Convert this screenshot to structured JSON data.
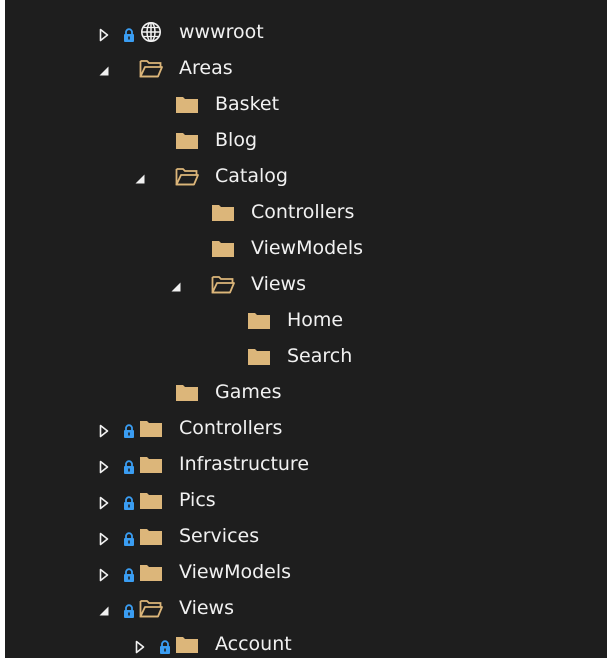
{
  "colors": {
    "panel_background": "#1e1e1e",
    "text": "#f1f1f1",
    "folder": "#dcb67a",
    "lock": "#3a9df2",
    "expander": "#f1f1f1"
  },
  "tree": {
    "items": [
      {
        "label": "wwwroot",
        "depth": 0,
        "expander": "collapsed",
        "icon": "globe-icon",
        "lock": true
      },
      {
        "label": "Areas",
        "depth": 0,
        "expander": "expanded",
        "icon": "folder-open-icon",
        "lock": false
      },
      {
        "label": "Basket",
        "depth": 1,
        "expander": "none",
        "icon": "folder-icon",
        "lock": false
      },
      {
        "label": "Blog",
        "depth": 1,
        "expander": "none",
        "icon": "folder-icon",
        "lock": false
      },
      {
        "label": "Catalog",
        "depth": 1,
        "expander": "expanded",
        "icon": "folder-open-icon",
        "lock": false
      },
      {
        "label": "Controllers",
        "depth": 2,
        "expander": "none",
        "icon": "folder-icon",
        "lock": false
      },
      {
        "label": "ViewModels",
        "depth": 2,
        "expander": "none",
        "icon": "folder-icon",
        "lock": false
      },
      {
        "label": "Views",
        "depth": 2,
        "expander": "expanded",
        "icon": "folder-open-icon",
        "lock": false
      },
      {
        "label": "Home",
        "depth": 3,
        "expander": "none",
        "icon": "folder-icon",
        "lock": false
      },
      {
        "label": "Search",
        "depth": 3,
        "expander": "none",
        "icon": "folder-icon",
        "lock": false
      },
      {
        "label": "Games",
        "depth": 1,
        "expander": "none",
        "icon": "folder-icon",
        "lock": false
      },
      {
        "label": "Controllers",
        "depth": 0,
        "expander": "collapsed",
        "icon": "folder-icon",
        "lock": true
      },
      {
        "label": "Infrastructure",
        "depth": 0,
        "expander": "collapsed",
        "icon": "folder-icon",
        "lock": true
      },
      {
        "label": "Pics",
        "depth": 0,
        "expander": "collapsed",
        "icon": "folder-icon",
        "lock": true
      },
      {
        "label": "Services",
        "depth": 0,
        "expander": "collapsed",
        "icon": "folder-icon",
        "lock": true
      },
      {
        "label": "ViewModels",
        "depth": 0,
        "expander": "collapsed",
        "icon": "folder-icon",
        "lock": true
      },
      {
        "label": "Views",
        "depth": 0,
        "expander": "expanded",
        "icon": "folder-open-icon",
        "lock": true
      },
      {
        "label": "Account",
        "depth": 1,
        "expander": "collapsed",
        "icon": "folder-icon",
        "lock": true
      }
    ]
  }
}
